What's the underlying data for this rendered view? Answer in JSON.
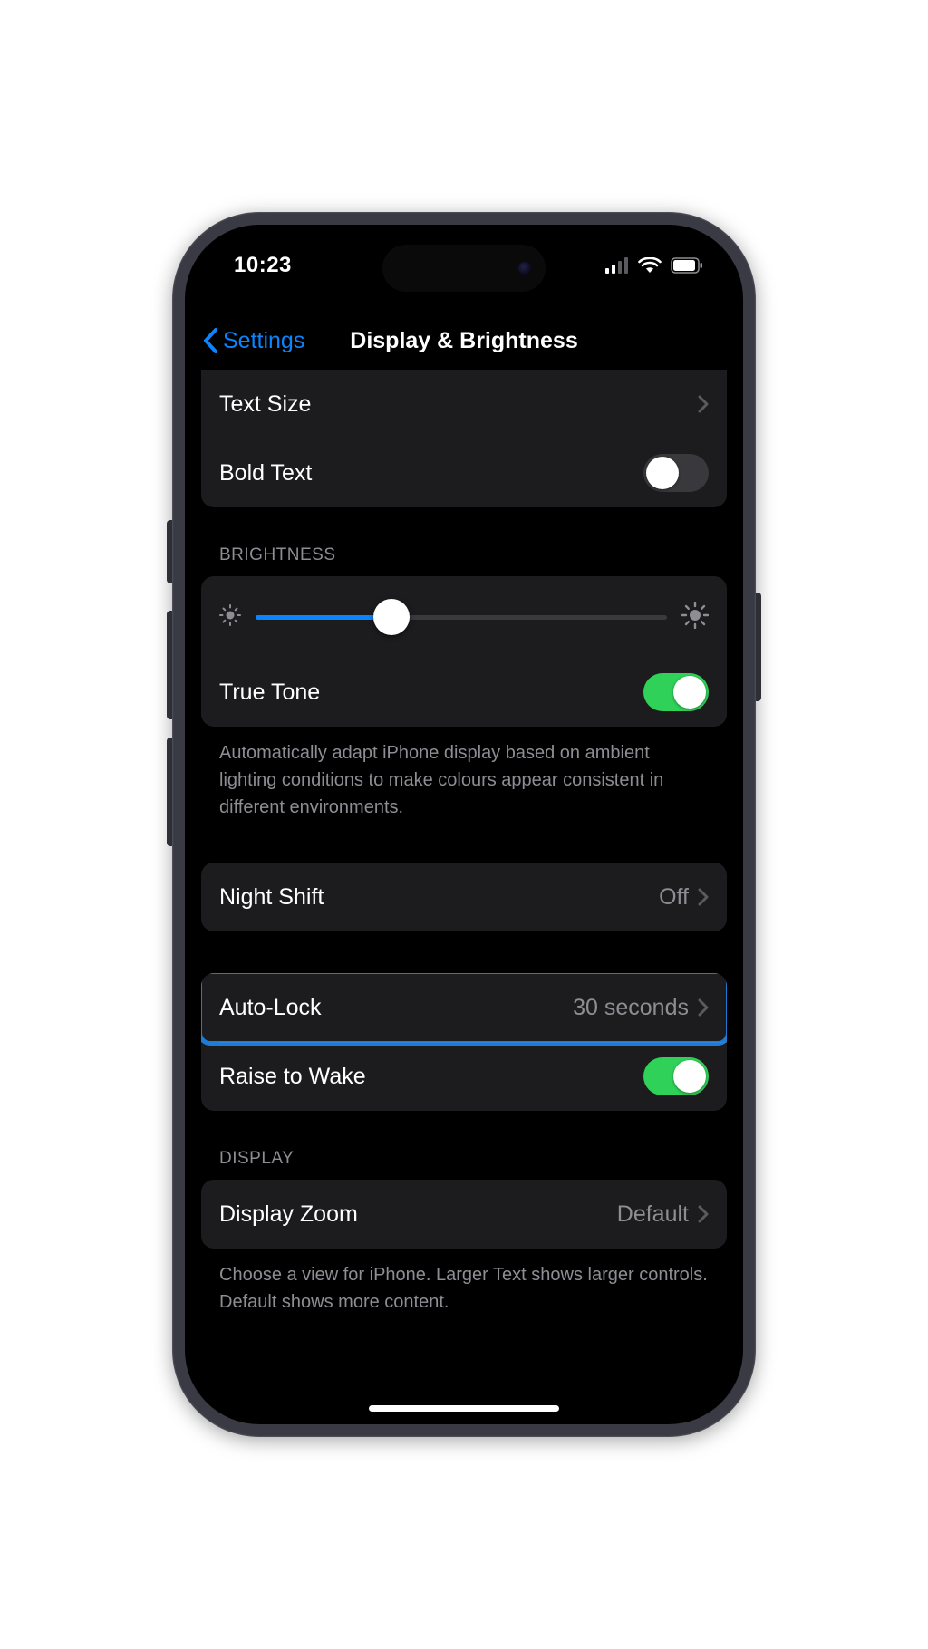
{
  "status": {
    "time": "10:23"
  },
  "nav": {
    "back_label": "Settings",
    "title": "Display & Brightness"
  },
  "text_group": {
    "text_size_label": "Text Size",
    "bold_text_label": "Bold Text",
    "bold_text_on": false
  },
  "brightness": {
    "header": "BRIGHTNESS",
    "slider_percent": 33,
    "true_tone_label": "True Tone",
    "true_tone_on": true,
    "footer": "Automatically adapt iPhone display based on ambient lighting conditions to make colours appear consistent in different environments."
  },
  "night_shift": {
    "label": "Night Shift",
    "value": "Off"
  },
  "auto_lock": {
    "label": "Auto-Lock",
    "value": "30 seconds"
  },
  "raise_to_wake": {
    "label": "Raise to Wake",
    "on": true
  },
  "display": {
    "header": "DISPLAY",
    "zoom_label": "Display Zoom",
    "zoom_value": "Default",
    "footer": "Choose a view for iPhone. Larger Text shows larger controls. Default shows more content."
  },
  "colors": {
    "accent": "#0a84ff",
    "toggle_on": "#30d158"
  }
}
